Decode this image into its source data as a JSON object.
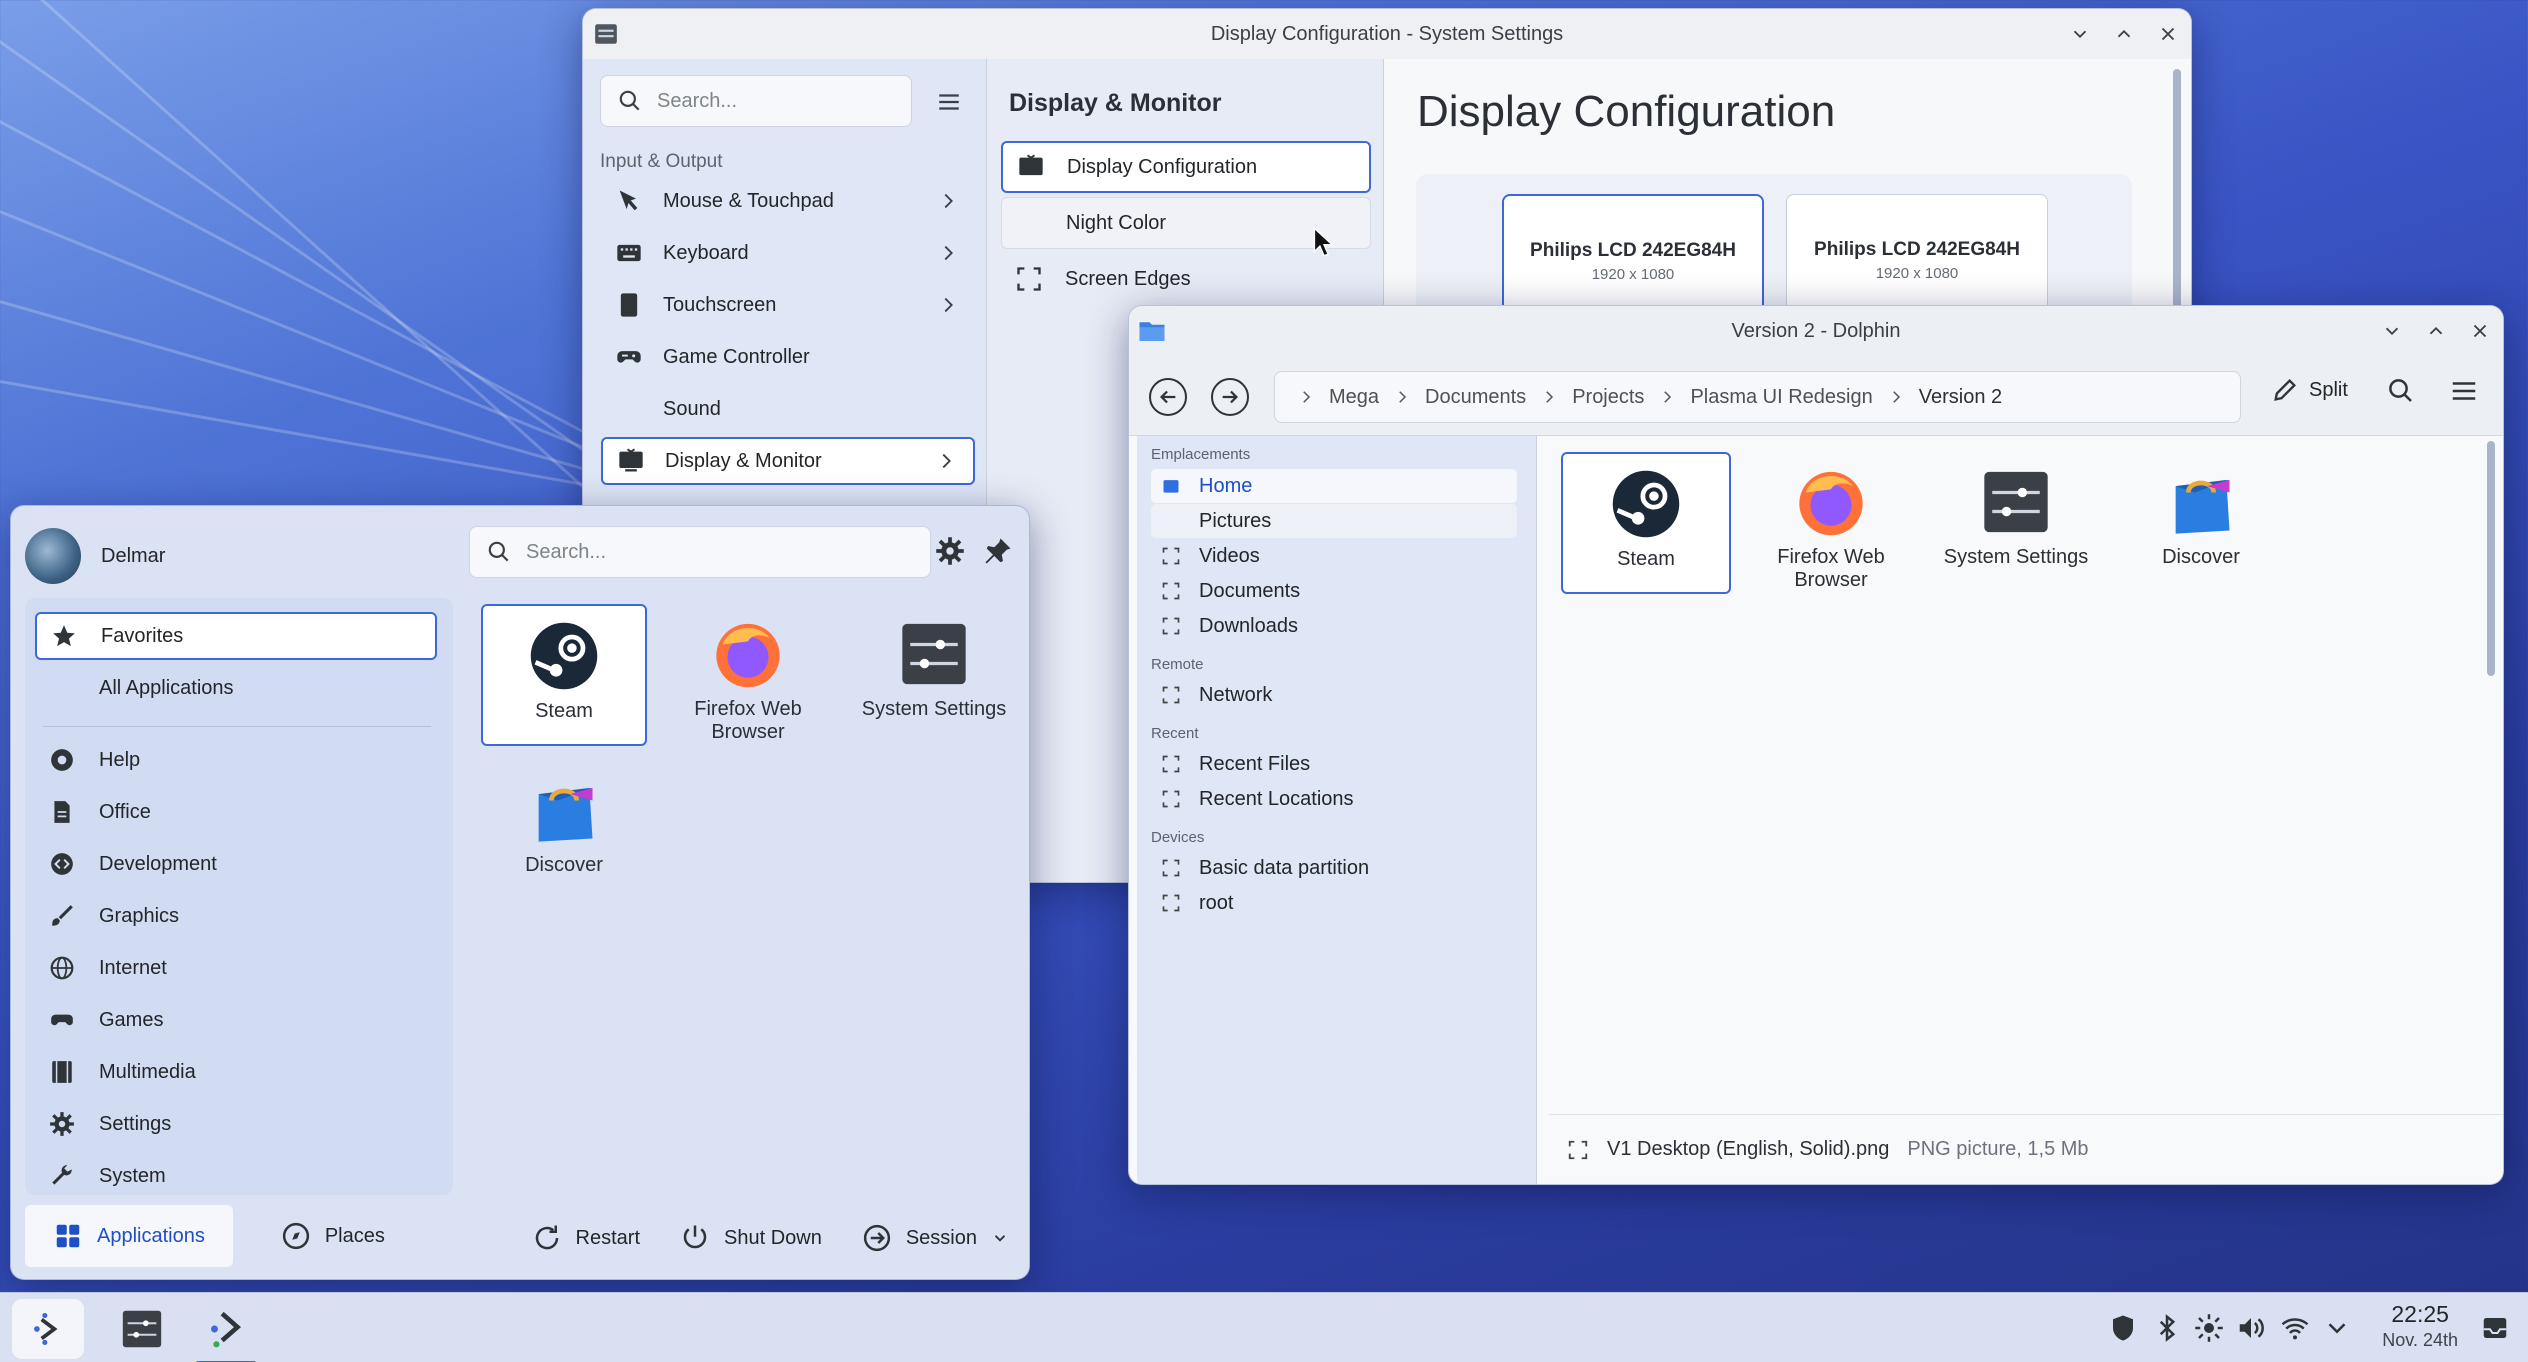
{
  "settings_window": {
    "title": "Display Configuration - System Settings",
    "search_placeholder": "Search...",
    "section": "Input & Output",
    "items": [
      {
        "label": "Mouse & Touchpad",
        "icon": "cursor-icon",
        "chevron": true
      },
      {
        "label": "Keyboard",
        "icon": "keyboard-icon",
        "chevron": true
      },
      {
        "label": "Touchscreen",
        "icon": "touchscreen-icon",
        "chevron": true
      },
      {
        "label": "Game Controller",
        "icon": "gamepad-icon",
        "chevron": false
      },
      {
        "label": "Sound",
        "icon": "sound-icon",
        "chevron": false
      },
      {
        "label": "Display & Monitor",
        "icon": "monitor-icon",
        "chevron": true,
        "selected": true
      }
    ],
    "sub_title": "Display & Monitor",
    "sub_items": [
      {
        "label": "Display Configuration",
        "icon": "display-icon",
        "selected": true
      },
      {
        "label": "Night Color",
        "icon": "night-color-icon"
      },
      {
        "label": "Screen Edges",
        "icon": "screen-edges-icon"
      }
    ],
    "page_title": "Display Configuration",
    "monitors": [
      {
        "name": "Philips LCD 242EG84H",
        "resolution": "1920 x 1080",
        "selected": true
      },
      {
        "name": "Philips LCD 242EG84H",
        "resolution": "1920 x 1080",
        "selected": false
      }
    ]
  },
  "dolphin_window": {
    "title": "Version 2 - Dolphin",
    "breadcrumbs": [
      "Mega",
      "Documents",
      "Projects",
      "Plasma UI Redesign",
      "Version 2"
    ],
    "split_label": "Split",
    "places": {
      "emplacements_label": "Emplacements",
      "emplacements": [
        "Home",
        "Pictures",
        "Videos",
        "Documents",
        "Downloads"
      ],
      "remote_label": "Remote",
      "remote": [
        "Network"
      ],
      "recent_label": "Recent",
      "recent": [
        "Recent Files",
        "Recent Locations"
      ],
      "devices_label": "Devices",
      "devices": [
        "Basic data partition",
        "root"
      ]
    },
    "files": [
      "Steam",
      "Firefox Web Browser",
      "System Settings",
      "Discover"
    ],
    "status_file": "V1 Desktop (English, Solid).png",
    "status_meta": "PNG picture, 1,5 Mb"
  },
  "launcher": {
    "user": "Delmar",
    "search_placeholder": "Search...",
    "categories_top": [
      "Favorites",
      "All Applications"
    ],
    "categories": [
      "Help",
      "Office",
      "Development",
      "Graphics",
      "Internet",
      "Games",
      "Multimedia",
      "Settings",
      "System"
    ],
    "apps": [
      "Steam",
      "Firefox Web Browser",
      "System Settings",
      "Discover"
    ],
    "tabs": [
      "Applications",
      "Places"
    ],
    "power": [
      "Restart",
      "Shut Down",
      "Session"
    ]
  },
  "taskbar": {
    "time": "22:25",
    "date": "Nov. 24th"
  },
  "colors": {
    "accent": "#3c68d8",
    "panel": "#dfe6f6"
  }
}
